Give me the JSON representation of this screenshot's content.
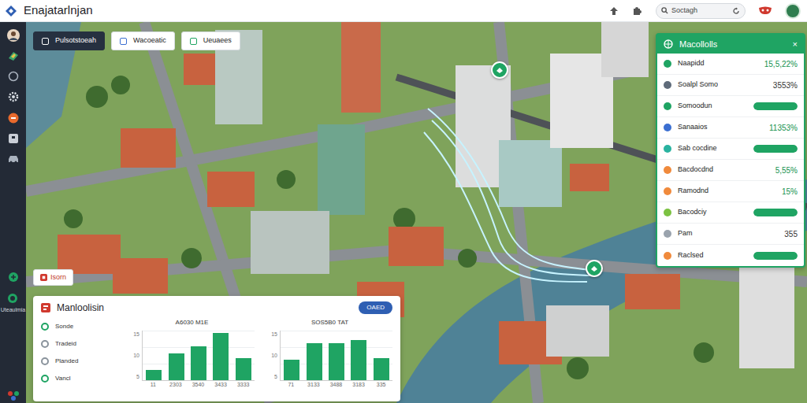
{
  "app": {
    "title": "Enajatarlnjan"
  },
  "search": {
    "placeholder": "Soctagh"
  },
  "sidebar": {
    "label": "Uteaulmia"
  },
  "chips": [
    {
      "label": "Pulsotstoeah",
      "selected": true
    },
    {
      "label": "Wacoeatic",
      "selected": false
    },
    {
      "label": "Ueuaees",
      "selected": false
    }
  ],
  "stats_panel": {
    "title": "Macollolls",
    "close": "×",
    "rows": [
      {
        "label": "Naapidd",
        "kind": "value",
        "value": "15,5,22%",
        "highlight": true,
        "color": "#1fa463"
      },
      {
        "label": "Soalpl Somo",
        "kind": "value",
        "value": "3553%",
        "highlight": false,
        "color": "#5f6b7a"
      },
      {
        "label": "Somoodun",
        "kind": "bar",
        "level": 1,
        "color": "#1fa463"
      },
      {
        "label": "Sanaaios",
        "kind": "value",
        "value": "11353%",
        "highlight": true,
        "color": "#3b6fd1"
      },
      {
        "label": "Sab cocdine",
        "kind": "bar",
        "level": 1,
        "color": "#2ab3a0"
      },
      {
        "label": "Bacdocdnd",
        "kind": "value",
        "value": "5,55%",
        "highlight": true,
        "color": "#f08a3c"
      },
      {
        "label": "Ramodnd",
        "kind": "value",
        "value": "15%",
        "highlight": true,
        "color": "#f08a3c"
      },
      {
        "label": "Bacodciy",
        "kind": "bar",
        "level": 1,
        "color": "#7cc242"
      },
      {
        "label": "Pam",
        "kind": "value",
        "value": "355",
        "highlight": false,
        "color": "#9aa3ad"
      },
      {
        "label": "Raclsed",
        "kind": "bar",
        "level": 1,
        "color": "#f08a3c"
      }
    ]
  },
  "layer_button": {
    "label": "Isorn"
  },
  "bottom_panel": {
    "title": "Manloolisin",
    "button": "OAED",
    "legend": [
      {
        "label": "Sonde",
        "color": "#1fa463"
      },
      {
        "label": "Tradeid",
        "color": "#8a939c"
      },
      {
        "label": "Planded",
        "color": "#8a939c"
      },
      {
        "label": "Vancl",
        "color": "#1fa463"
      }
    ],
    "charts": [
      {
        "title": "A6030 M1E",
        "ticks": [
          "15",
          "10",
          "5"
        ],
        "labels": [
          "11",
          "2303",
          "3540",
          "3433",
          "3333"
        ],
        "values": [
          3,
          8,
          10,
          14,
          6.5
        ]
      },
      {
        "title": "SOS5B0 TAT",
        "ticks": [
          "15",
          "10",
          "5"
        ],
        "labels": [
          "71",
          "3133",
          "3488",
          "3183",
          "335"
        ],
        "values": [
          6,
          11,
          11,
          12,
          6.5
        ]
      }
    ]
  }
}
